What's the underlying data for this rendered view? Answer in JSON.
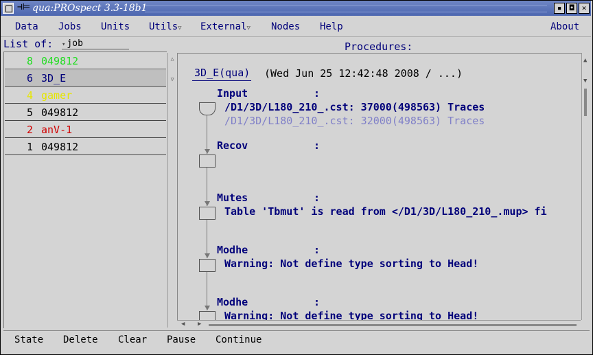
{
  "window": {
    "title": "qua:PROspect 3.3-18b1",
    "pin_glyph": "⊣⊨",
    "min_glyph": "▪",
    "max_glyph": "◘",
    "close_glyph": "✕"
  },
  "menu": {
    "items": [
      "Data",
      "Jobs",
      "Units",
      "Utils",
      "External",
      "Nodes",
      "Help"
    ],
    "about": "About"
  },
  "list": {
    "label": "List of:",
    "select_value": "job",
    "jobs": [
      {
        "num": "8",
        "name": "049812",
        "color": "#22dd22"
      },
      {
        "num": "6",
        "name": "3D_E",
        "color": "#00007a"
      },
      {
        "num": "4",
        "name": "gamer",
        "color": "#e6e600"
      },
      {
        "num": "5",
        "name": "049812",
        "color": "#000000"
      },
      {
        "num": "2",
        "name": "anV-1",
        "color": "#d00000"
      },
      {
        "num": "1",
        "name": "049812",
        "color": "#000000"
      }
    ]
  },
  "procedures": {
    "label": "Procedures:",
    "tab": "3D_E(qua)",
    "tab_info": "(Wed Jun 25 12:42:48 2008 / ...)",
    "steps": [
      {
        "name": "Input",
        "colon": ":",
        "lines": [
          "/D1/3D/L180_210_.cst: 37000(498563) Traces",
          "/D1/3D/L180_210_.cst: 32000(498563) Traces"
        ]
      },
      {
        "name": "Recov",
        "colon": ":",
        "lines": []
      },
      {
        "name": "Mutes",
        "colon": ":",
        "lines": [
          "Table 'Tbmut' is read from </D1/3D/L180_210_.mup> fi"
        ]
      },
      {
        "name": "Modhe",
        "colon": ":",
        "lines": [
          "Warning: Not define type sorting to Head!"
        ]
      },
      {
        "name": "Modhe",
        "colon": ":",
        "lines": [
          "Warning: Not define type sorting to Head!"
        ]
      }
    ]
  },
  "bottom": {
    "buttons": [
      "State",
      "Delete",
      "Clear",
      "Pause",
      "Continue"
    ]
  },
  "colors": {
    "accent_text": "#00007a",
    "title_bar": "#5a72b8",
    "background": "#d4d4d4",
    "selection": "#bfbfbf"
  }
}
